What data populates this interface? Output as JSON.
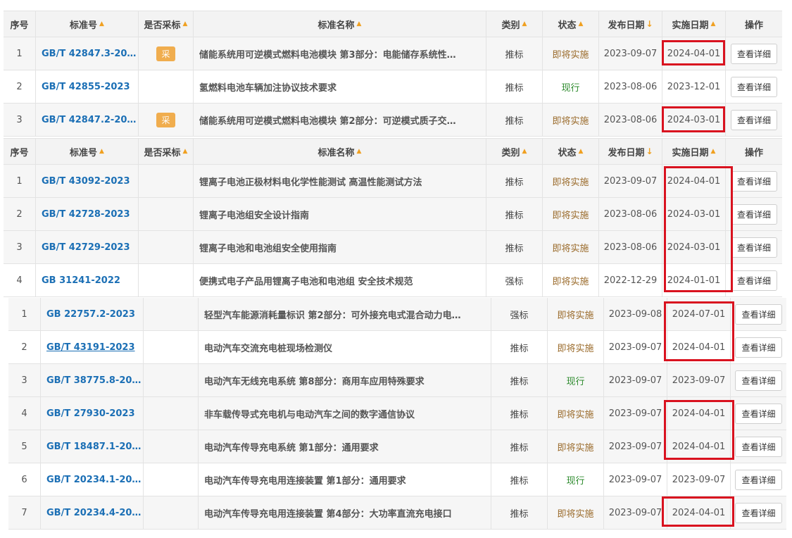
{
  "headers": {
    "seq": "序号",
    "code": "标准号",
    "adopt": "是否采标",
    "name": "标准名称",
    "cat": "类别",
    "status": "状态",
    "pub": "发布日期",
    "impl": "实施日期",
    "op": "操作"
  },
  "tables": [
    {
      "rows": [
        {
          "seq": "1",
          "code": "GB/T 42847.3-20…",
          "adopt": "采",
          "name": "储能系统用可逆模式燃料电池模块 第3部分：电能储存系统性…",
          "cat": "推标",
          "status": "即将实施",
          "pub": "2023-09-07",
          "impl": "2024-04-01",
          "op": "查看详细"
        },
        {
          "seq": "2",
          "code": "GB/T 42855-2023",
          "adopt": "",
          "name": "氢燃料电池车辆加注协议技术要求",
          "cat": "推标",
          "status": "现行",
          "pub": "2023-08-06",
          "impl": "2023-12-01",
          "op": "查看详细"
        },
        {
          "seq": "3",
          "code": "GB/T 42847.2-20…",
          "adopt": "采",
          "name": "储能系统用可逆模式燃料电池模块 第2部分：可逆模式质子交…",
          "cat": "推标",
          "status": "即将实施",
          "pub": "2023-08-06",
          "impl": "2024-03-01",
          "op": "查看详细"
        }
      ]
    },
    {
      "rows": [
        {
          "seq": "1",
          "code": "GB/T 43092-2023",
          "adopt": "",
          "name": "锂离子电池正极材料电化学性能测试 高温性能测试方法",
          "cat": "推标",
          "status": "即将实施",
          "pub": "2023-09-07",
          "impl": "2024-04-01",
          "op": "查看详细"
        },
        {
          "seq": "2",
          "code": "GB/T 42728-2023",
          "adopt": "",
          "name": "锂离子电池组安全设计指南",
          "cat": "推标",
          "status": "即将实施",
          "pub": "2023-08-06",
          "impl": "2024-03-01",
          "op": "查看详细"
        },
        {
          "seq": "3",
          "code": "GB/T 42729-2023",
          "adopt": "",
          "name": "锂离子电池和电池组安全使用指南",
          "cat": "推标",
          "status": "即将实施",
          "pub": "2023-08-06",
          "impl": "2024-03-01",
          "op": "查看详细"
        },
        {
          "seq": "4",
          "code": "GB 31241-2022",
          "adopt": "",
          "name": "便携式电子产品用锂离子电池和电池组 安全技术规范",
          "cat": "强标",
          "status": "即将实施",
          "pub": "2022-12-29",
          "impl": "2024-01-01",
          "op": "查看详细"
        }
      ]
    },
    {
      "rows": [
        {
          "seq": "1",
          "code": "GB 22757.2-2023",
          "adopt": "",
          "name": "轻型汽车能源消耗量标识 第2部分：可外接充电式混合动力电…",
          "cat": "强标",
          "status": "即将实施",
          "pub": "2023-09-08",
          "impl": "2024-07-01",
          "op": "查看详细"
        },
        {
          "seq": "2",
          "code": "GB/T 43191-2023",
          "adopt": "",
          "name": "电动汽车交流充电桩现场检测仪",
          "cat": "推标",
          "status": "即将实施",
          "pub": "2023-09-07",
          "impl": "2024-04-01",
          "op": "查看详细"
        },
        {
          "seq": "3",
          "code": "GB/T 38775.8-20…",
          "adopt": "",
          "name": "电动汽车无线充电系统 第8部分：商用车应用特殊要求",
          "cat": "推标",
          "status": "现行",
          "pub": "2023-09-07",
          "impl": "2023-09-07",
          "op": "查看详细"
        },
        {
          "seq": "4",
          "code": "GB/T 27930-2023",
          "adopt": "",
          "name": "非车载传导式充电机与电动汽车之间的数字通信协议",
          "cat": "推标",
          "status": "即将实施",
          "pub": "2023-09-07",
          "impl": "2024-04-01",
          "op": "查看详细"
        },
        {
          "seq": "5",
          "code": "GB/T 18487.1-20…",
          "adopt": "",
          "name": "电动汽车传导充电系统 第1部分：通用要求",
          "cat": "推标",
          "status": "即将实施",
          "pub": "2023-09-07",
          "impl": "2024-04-01",
          "op": "查看详细"
        },
        {
          "seq": "6",
          "code": "GB/T 20234.1-20…",
          "adopt": "",
          "name": "电动汽车传导充电用连接装置 第1部分：通用要求",
          "cat": "推标",
          "status": "现行",
          "pub": "2023-09-07",
          "impl": "2023-09-07",
          "op": "查看详细"
        },
        {
          "seq": "7",
          "code": "GB/T 20234.4-20…",
          "adopt": "",
          "name": "电动汽车传导充电用连接装置 第4部分：大功率直流充电接口",
          "cat": "推标",
          "status": "即将实施",
          "pub": "2023-09-07",
          "impl": "2024-04-01",
          "op": "查看详细"
        }
      ]
    }
  ]
}
